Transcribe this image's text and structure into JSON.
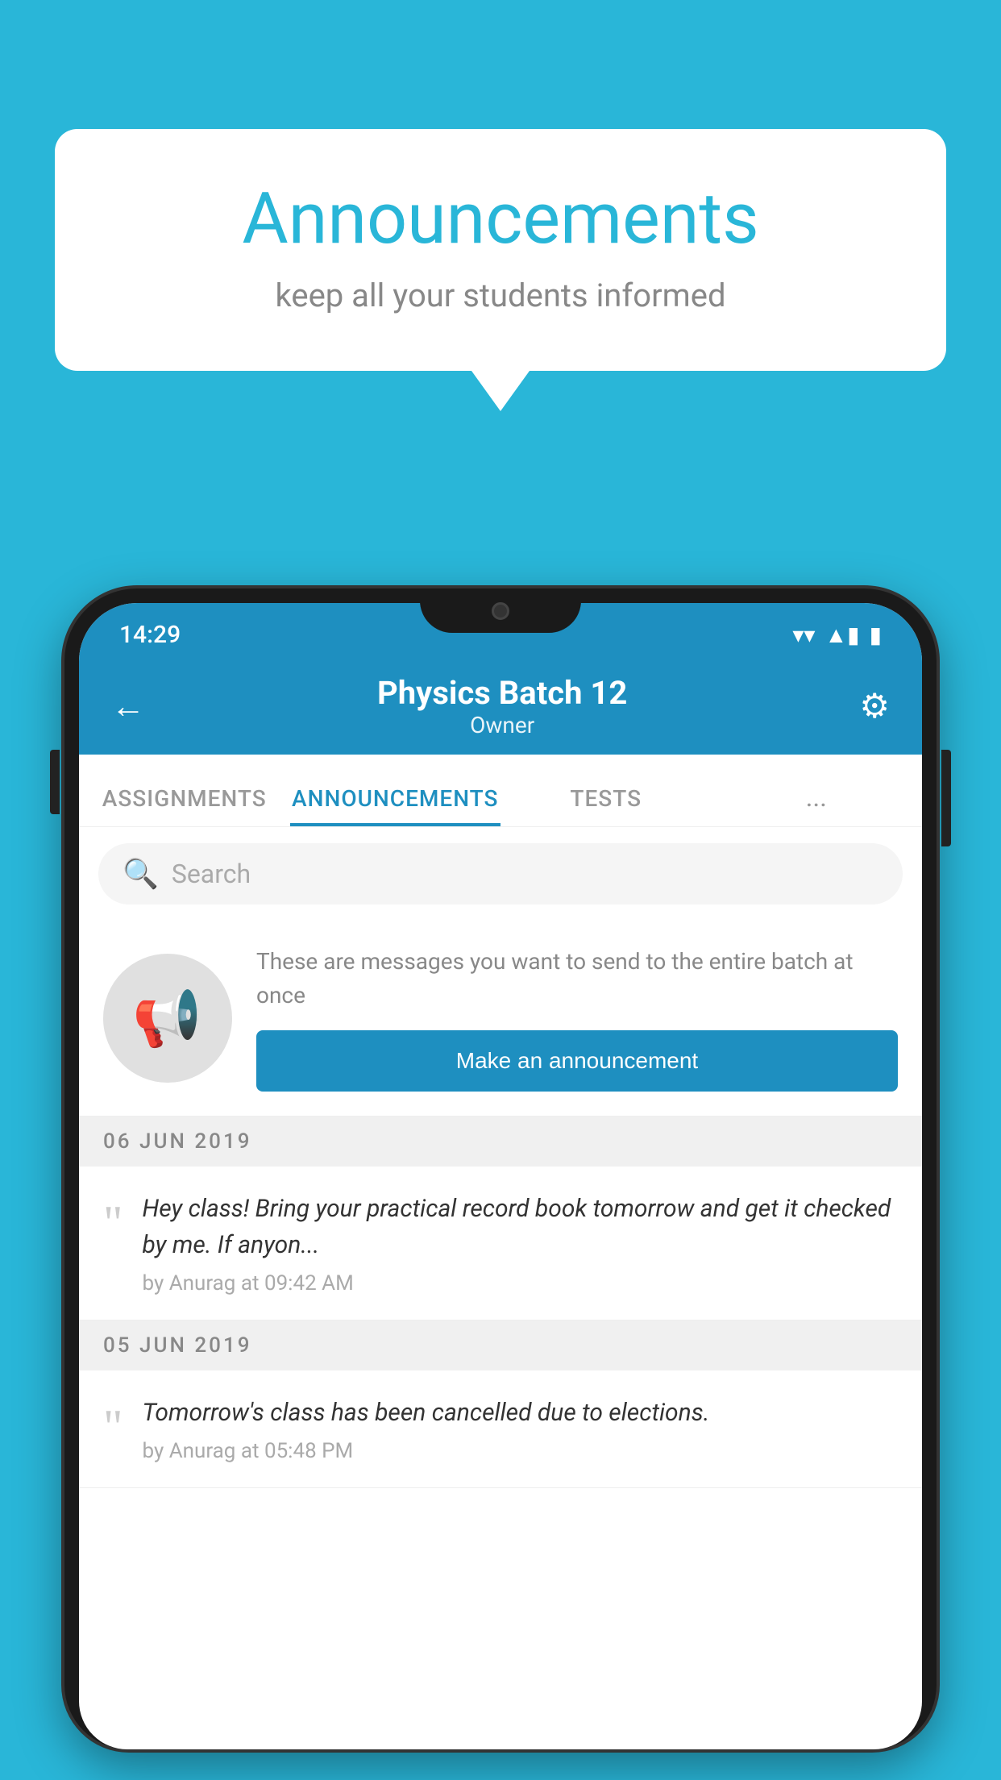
{
  "background": {
    "color": "#29b6d8"
  },
  "speech_bubble": {
    "title": "Announcements",
    "subtitle": "keep all your students informed"
  },
  "phone": {
    "status_bar": {
      "time": "14:29",
      "wifi": "▼",
      "signal": "▲",
      "battery": "▮"
    },
    "header": {
      "title": "Physics Batch 12",
      "subtitle": "Owner",
      "back_label": "←",
      "settings_label": "⚙"
    },
    "tabs": [
      {
        "label": "ASSIGNMENTS",
        "active": false
      },
      {
        "label": "ANNOUNCEMENTS",
        "active": true
      },
      {
        "label": "TESTS",
        "active": false
      },
      {
        "label": "...",
        "active": false
      }
    ],
    "search": {
      "placeholder": "Search"
    },
    "promo": {
      "description": "These are messages you want to send to the entire batch at once",
      "button_label": "Make an announcement"
    },
    "announcements": [
      {
        "date": "06  JUN  2019",
        "text": "Hey class! Bring your practical record book tomorrow and get it checked by me. If anyon...",
        "meta": "by Anurag at 09:42 AM"
      },
      {
        "date": "05  JUN  2019",
        "text": "Tomorrow's class has been cancelled due to elections.",
        "meta": "by Anurag at 05:48 PM"
      }
    ]
  }
}
